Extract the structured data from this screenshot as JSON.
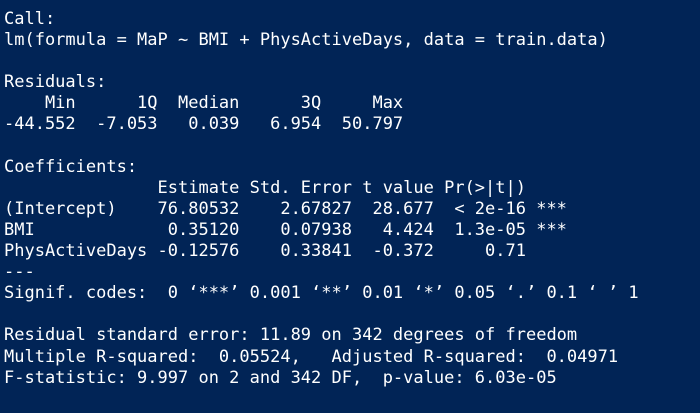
{
  "console": {
    "lines": [
      "Call:",
      "lm(formula = MaP ~ BMI + PhysActiveDays, data = train.data)",
      "",
      "Residuals:",
      "    Min      1Q  Median      3Q     Max ",
      "-44.552  -7.053   0.039   6.954  50.797 ",
      "",
      "Coefficients:",
      "               Estimate Std. Error t value Pr(>|t|)    ",
      "(Intercept)    76.80532    2.67827  28.677  < 2e-16 ***",
      "BMI             0.35120    0.07938   4.424  1.3e-05 ***",
      "PhysActiveDays -0.12576    0.33841  -0.372     0.71    ",
      "---",
      "Signif. codes:  0 ‘***’ 0.001 ‘**’ 0.01 ‘*’ 0.05 ‘.’ 0.1 ‘ ’ 1",
      "",
      "Residual standard error: 11.89 on 342 degrees of freedom",
      "Multiple R-squared:  0.05524,\tAdjusted R-squared:  0.04971 ",
      "F-statistic: 9.997 on 2 and 342 DF,  p-value: 6.03e-05"
    ]
  }
}
